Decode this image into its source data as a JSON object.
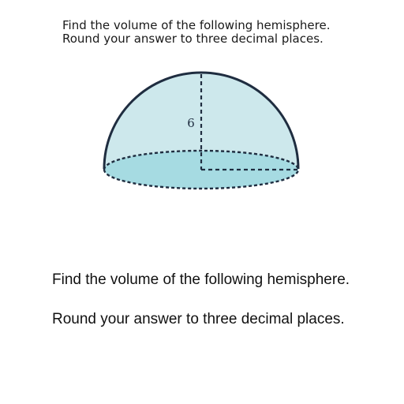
{
  "header": {
    "line1": "Find the volume of the following hemisphere.",
    "line2": "Round your answer to three decimal places."
  },
  "figure": {
    "radius_label": "6",
    "colors": {
      "dome_fill": "#cde8ec",
      "base_fill": "#a6dbe2",
      "outline": "#1f2d40"
    }
  },
  "question": {
    "line1": "Find the volume of the following hemisphere.",
    "line2": "Round your answer to three decimal places."
  }
}
